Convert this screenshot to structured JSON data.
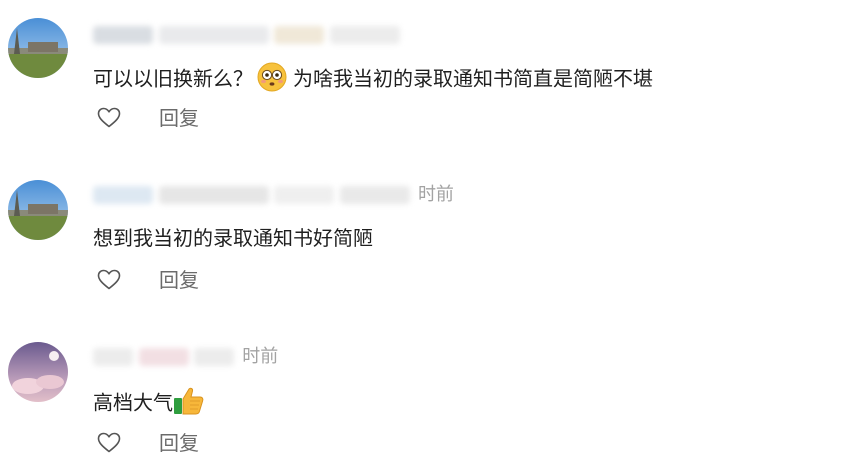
{
  "comments": [
    {
      "username": "",
      "time": "",
      "text": "可以以旧换新么？",
      "text_after_emoji": "为啥我当初的录取通知书简直是简陋不堪",
      "emoji": "flushed-face",
      "reply_label": "回复",
      "liked": false
    },
    {
      "username": "",
      "time": "时前",
      "text": "想到我当初的录取通知书好简陋",
      "reply_label": "回复",
      "liked": false
    },
    {
      "username": "",
      "time": "时前",
      "text": "高档大气",
      "emoji": "thumbs-up",
      "reply_label": "回复",
      "liked": false
    }
  ],
  "colors": {
    "text": "#1f1f1f",
    "meta": "#a3a3a3",
    "action": "#6b6b6b"
  }
}
